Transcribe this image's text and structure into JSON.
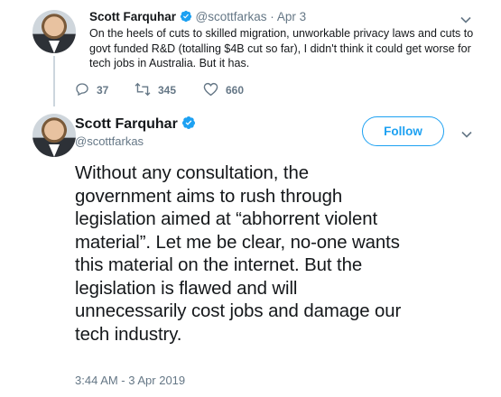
{
  "parent_tweet": {
    "name": "Scott Farquhar",
    "handle": "@scottfarkas",
    "separator": "·",
    "date": "Apr 3",
    "text_lines": [
      "On the heels of cuts to skilled migration, unworkable privacy laws and cuts to",
      "govt funded R&D (totalling $4B cut so far), I didn't think it could get worse for",
      "tech jobs in Australia.  But it has."
    ],
    "replies": "37",
    "retweets": "345",
    "likes": "660",
    "icons": [
      "verified-badge-icon",
      "chevron-down-icon",
      "reply-icon",
      "retweet-icon",
      "heart-icon"
    ]
  },
  "main_tweet": {
    "name": "Scott Farquhar",
    "handle": "@scottfarkas",
    "follow_label": "Follow",
    "text_lines": [
      "Without any consultation, the",
      "government aims to rush through",
      "legislation aimed at “abhorrent violent",
      "material”.  Let me be clear, no-one wants",
      "this material on the internet. But the",
      "legislation is flawed and will",
      "unnecessarily cost jobs and damage our",
      "tech industry."
    ],
    "timestamp": "3:44 AM - 3 Apr 2019"
  },
  "colors": {
    "accent": "#1da1f2",
    "text": "#14171a",
    "muted": "#657786",
    "thread_line": "#ccd6dd"
  }
}
